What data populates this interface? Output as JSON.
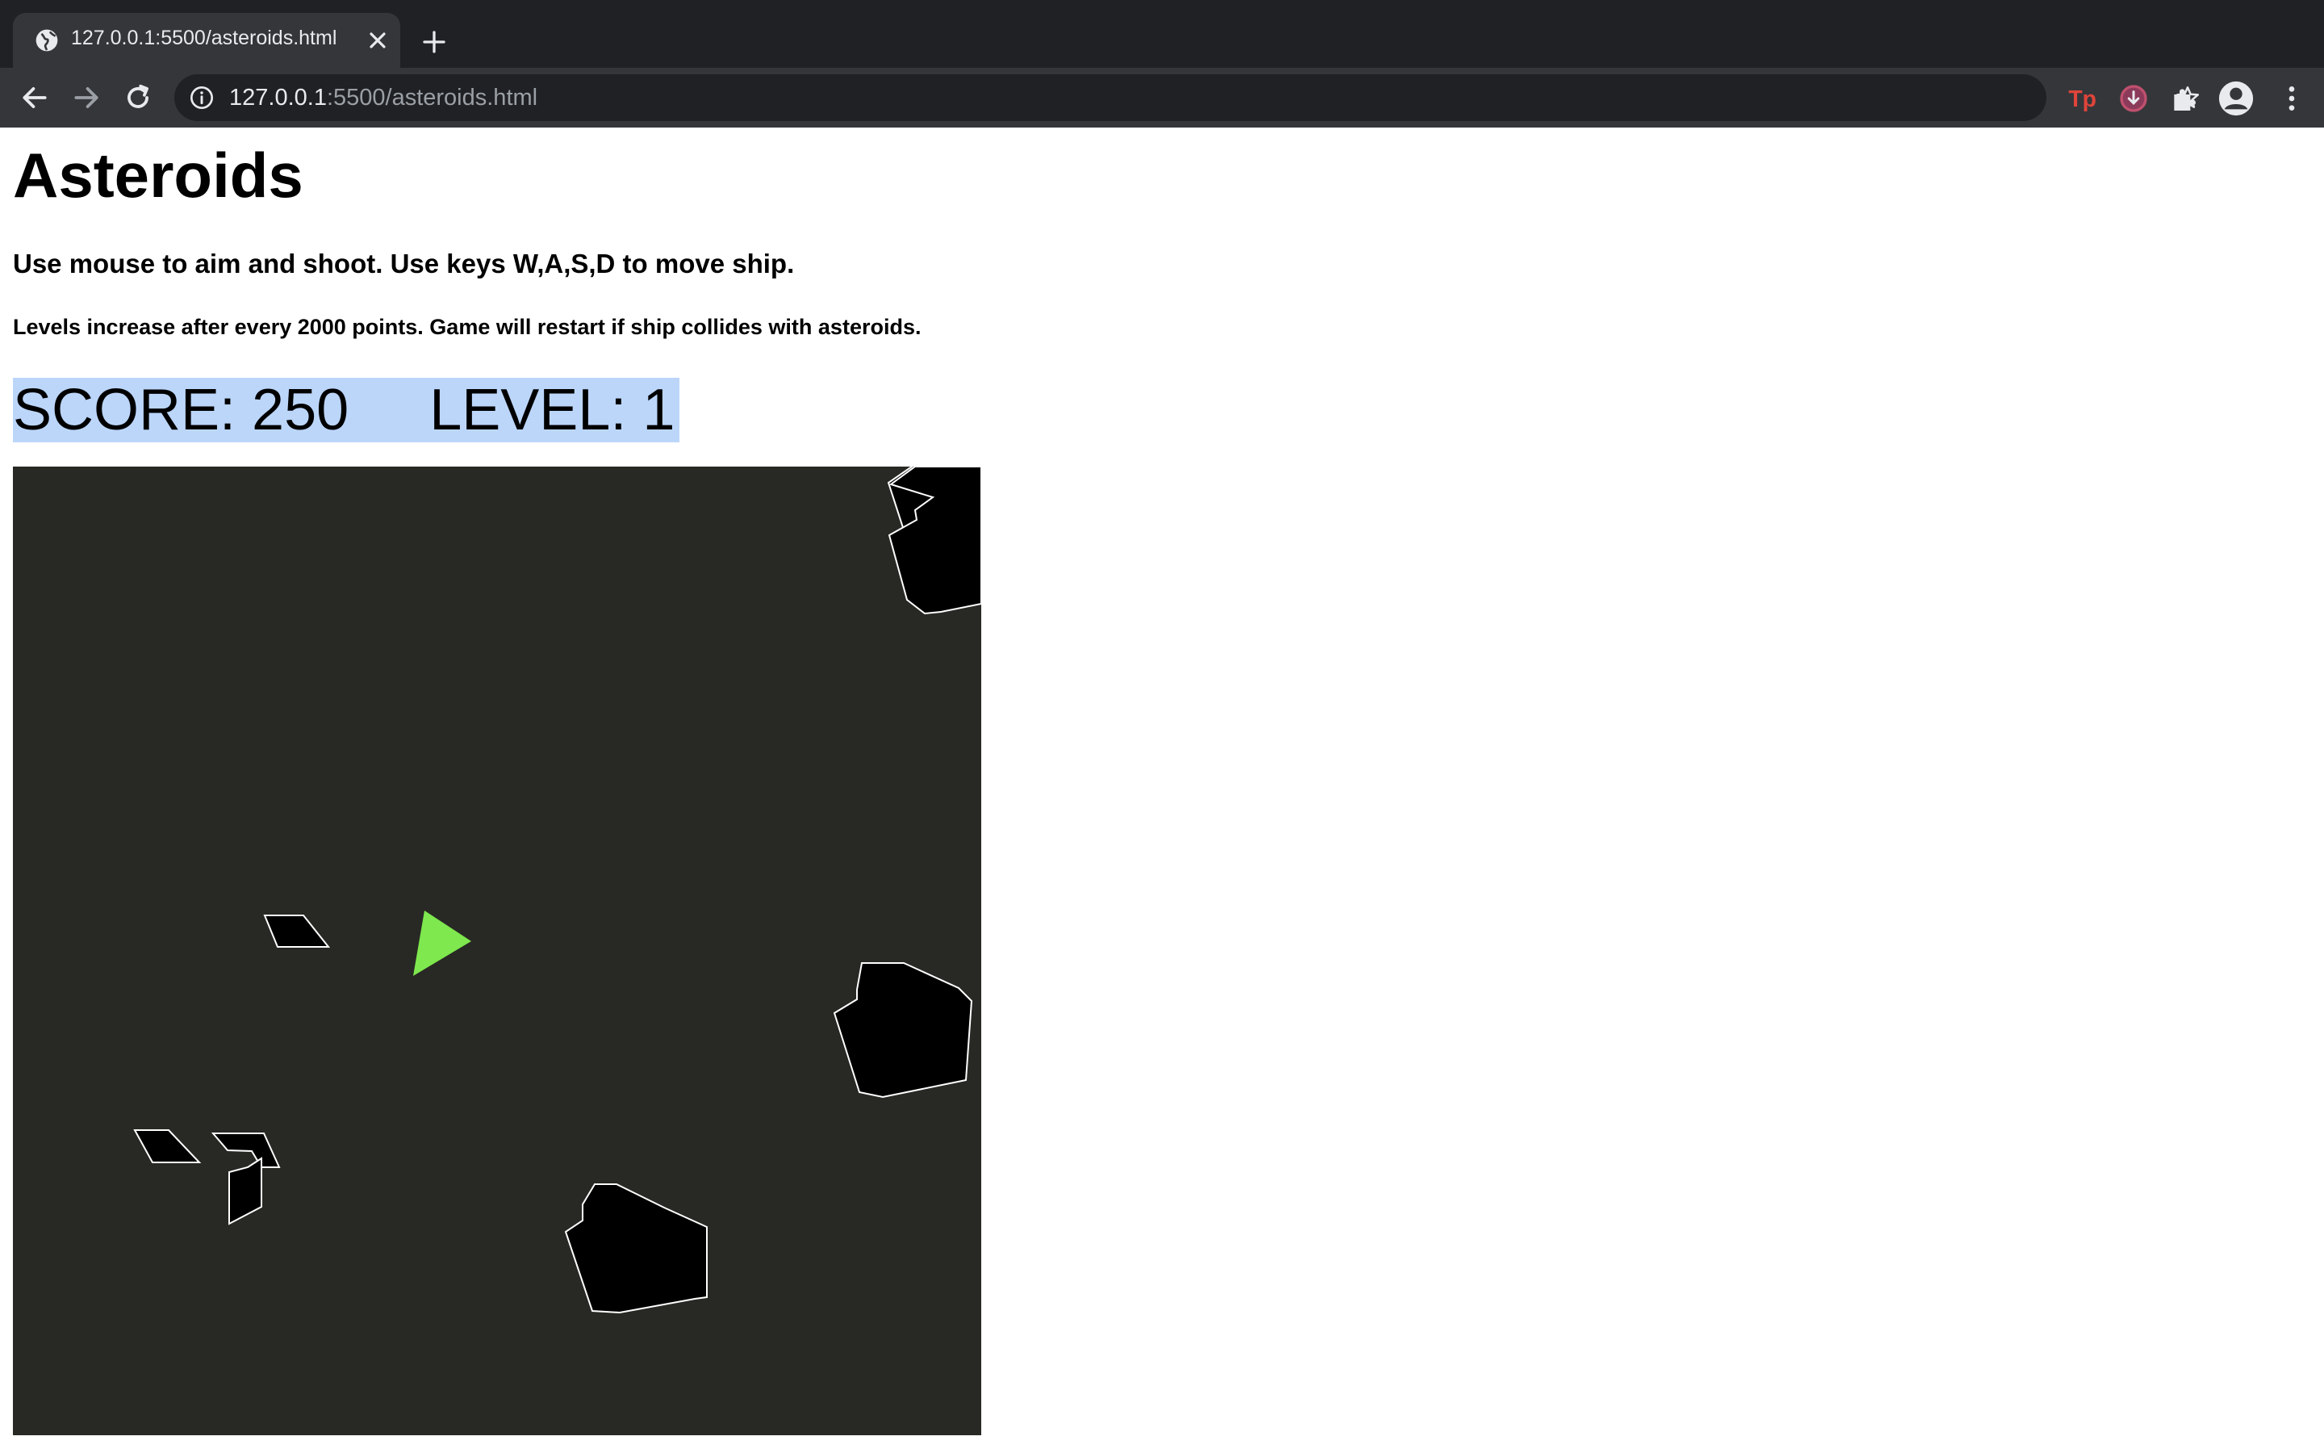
{
  "browser": {
    "tab_title": "127.0.0.1:5500/asteroids.html",
    "url_host": "127.0.0.1",
    "url_rest": ":5500/asteroids.html"
  },
  "page": {
    "title": "Asteroids",
    "instructions": "Use mouse to aim and shoot. Use keys W,A,S,D to move ship.",
    "rules": "Levels increase after every 2000 points. Game will restart if ship collides with asteroids.",
    "score_label": "SCORE: 250",
    "level_label": "LEVEL: 1"
  },
  "game": {
    "background": "#282924",
    "ship_color": "#7ee84e",
    "asteroid_fill": "#000000",
    "asteroid_stroke": "#ffffff"
  },
  "icons": {
    "tab_favicon": "globe-icon",
    "tab_close": "close-icon",
    "new_tab": "plus-icon",
    "back": "back-arrow-icon",
    "forward": "forward-arrow-icon",
    "reload": "reload-icon",
    "site_info": "info-icon",
    "bookmark": "star-icon",
    "extension_1": "tp-extension-icon",
    "extension_2": "download-extension-icon",
    "extensions": "puzzle-icon",
    "profile": "profile-avatar-icon",
    "menu": "kebab-menu-icon"
  }
}
